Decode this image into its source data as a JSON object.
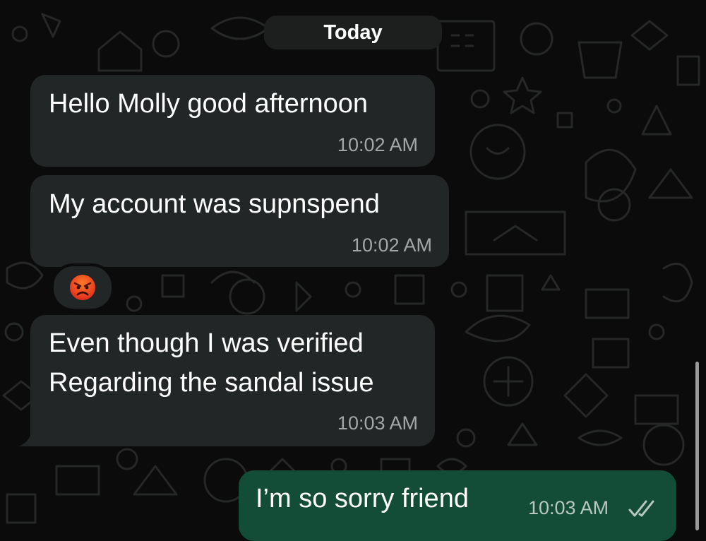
{
  "header": {
    "date_label": "Today"
  },
  "messages": [
    {
      "direction": "incoming",
      "lines": [
        "Hello Molly good afternoon"
      ],
      "time": "10:02 AM"
    },
    {
      "direction": "incoming",
      "lines": [
        "My account was supnspend"
      ],
      "time": "10:02 AM",
      "reaction": "angry-face"
    },
    {
      "direction": "incoming",
      "lines": [
        "Even though I was verified",
        "Regarding the sandal issue"
      ],
      "time": "10:03 AM"
    },
    {
      "direction": "outgoing",
      "lines": [
        "I’m so sorry friend"
      ],
      "time": "10:03 AM",
      "status": "read"
    }
  ],
  "colors": {
    "background": "#0b0b0b",
    "incoming_bubble": "#232626",
    "outgoing_bubble": "#134d37",
    "timestamp": "#a3a7a7",
    "read_ticks": "#b8c8c0"
  },
  "icons": {
    "reaction": "angry-face-icon",
    "status": "double-check-icon",
    "wallpaper": "doodle-pattern"
  }
}
